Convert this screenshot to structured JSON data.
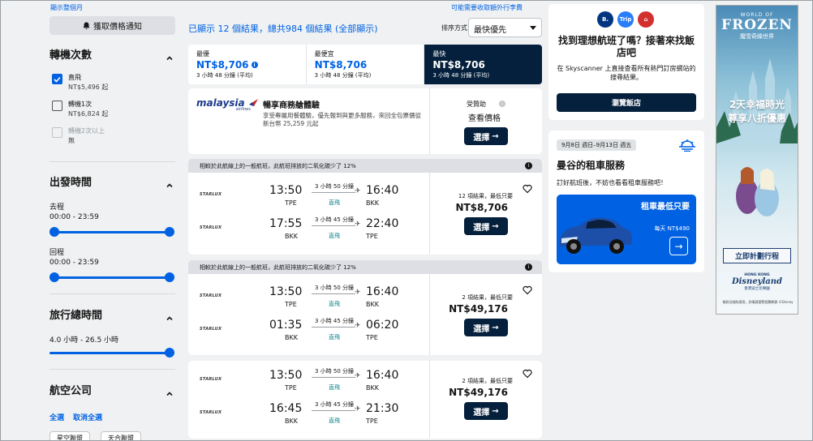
{
  "sidebar": {
    "top_link": "顯示整個月",
    "alert_button": "獲取價格通知",
    "stops": {
      "title": "轉機次數",
      "options": [
        {
          "label": "直飛",
          "sub": "NT$5,496 起",
          "checked": true,
          "disabled": false
        },
        {
          "label": "轉機1次",
          "sub": "NT$6,824 起",
          "checked": false,
          "disabled": false
        },
        {
          "label": "轉機2次以上",
          "sub": "無",
          "checked": false,
          "disabled": true
        }
      ]
    },
    "departure_time": {
      "title": "出發時間",
      "outbound_label": "去程",
      "outbound_range": "00:00 - 23:59",
      "return_label": "回程",
      "return_range": "00:00 - 23:59"
    },
    "duration": {
      "title": "旅行總時間",
      "range": "4.0 小時 - 26.5 小時"
    },
    "airlines": {
      "title": "航空公司",
      "select_all": "全選",
      "clear_all": "取消全選",
      "alliance_btn_1": "星空聯盟",
      "alliance_btn_2": "天合聯盟"
    }
  },
  "main": {
    "results_text": "已顯示 12 個結果，總共984 個結果 (全部顯示)",
    "sort_label": "排序方式",
    "sort_value": "最快優先",
    "fees_link": "可能需要收取額外行李費",
    "tabs": [
      {
        "name": "最優",
        "price": "NT$8,706",
        "duration": "3 小時 48 分鐘 (平均)",
        "active": false
      },
      {
        "name": "最便宜",
        "price": "NT$8,706",
        "duration": "3 小時 48 分鐘 (平均)",
        "active": false
      },
      {
        "name": "最快",
        "price": "NT$8,706",
        "duration": "3 小時 48 分鐘 (平均)",
        "active": true
      }
    ],
    "ad": {
      "logo_text": "malaysia",
      "logo_sub": "airlines",
      "title": "暢享商務艙體驗",
      "description": "享受專屬用餐體驗，優先報到與更多服務，來回全包票價從新台幣 25,259 元起",
      "sponsored": "受贊助",
      "view_price": "查看價格",
      "select": "選擇"
    },
    "eco_banner": "相較於此航線上的一般航班，此航班排放的二氧化碳少了 12%",
    "results": [
      {
        "has_banner": true,
        "legs": [
          {
            "airline": "STARLUX",
            "dep": "13:50",
            "dep_code": "TPE",
            "dur": "3 小時 50 分鐘",
            "stop": "直飛",
            "arr": "16:40",
            "arr_code": "BKK"
          },
          {
            "airline": "STARLUX",
            "dep": "17:55",
            "dep_code": "BKK",
            "dur": "3 小時 45 分鐘",
            "stop": "直飛",
            "arr": "22:40",
            "arr_code": "TPE"
          }
        ],
        "note": "12 項結果，最低只要",
        "price": "NT$8,706",
        "select": "選擇"
      },
      {
        "has_banner": true,
        "legs": [
          {
            "airline": "STARLUX",
            "dep": "13:50",
            "dep_code": "TPE",
            "dur": "3 小時 50 分鐘",
            "stop": "直飛",
            "arr": "16:40",
            "arr_code": "BKK"
          },
          {
            "airline": "STARLUX",
            "dep": "01:35",
            "dep_code": "BKK",
            "dur": "3 小時 45 分鐘",
            "stop": "直飛",
            "arr": "06:20",
            "arr_code": "TPE"
          }
        ],
        "note": "2 項結果，最低只要",
        "price": "NT$49,176",
        "select": "選擇"
      },
      {
        "has_banner": false,
        "legs": [
          {
            "airline": "STARLUX",
            "dep": "13:50",
            "dep_code": "TPE",
            "dur": "3 小時 50 分鐘",
            "stop": "直飛",
            "arr": "16:40",
            "arr_code": "BKK"
          },
          {
            "airline": "STARLUX",
            "dep": "16:45",
            "dep_code": "BKK",
            "dur": "3 小時 45 分鐘",
            "stop": "直飛",
            "arr": "21:30",
            "arr_code": "TPE"
          }
        ],
        "note": "2 項結果，最低只要",
        "price": "NT$49,176",
        "select": "選擇"
      }
    ]
  },
  "right": {
    "hotel": {
      "logos": [
        {
          "text": "B.",
          "color": "#003580"
        },
        {
          "text": "Trip",
          "color": "#287dfa"
        },
        {
          "text": "⌂",
          "color": "#d32f2f"
        }
      ],
      "title": "找到理想航班了嗎？接著來找飯店吧",
      "desc": "在 Skyscanner 上直接查看所有熱門訂房網站的搜尋結果。",
      "button": "瀏覽飯店"
    },
    "car": {
      "date_badge": "9月8日 週日–9月13日 週五",
      "title": "曼谷的租車服務",
      "desc": "訂好航班後，不妨也看看租車服務吧！",
      "headline": "租車最低只要",
      "daily": "每天 NT$490"
    },
    "frozen_ad": {
      "world": "WORLD OF",
      "word": "FROZEN",
      "cn_sub": "魔雪奇緣世界",
      "promo_line1": "2天幸福時光",
      "promo_line2": "尊享八折優惠",
      "cta": "立即計劃行程",
      "hk": "HONG KONG",
      "dl": "Disneyland",
      "resort": "香港迪士尼樂園",
      "fine": "條款及細則適用，詳情請瀏覽相關網頁 ©Disney"
    }
  }
}
